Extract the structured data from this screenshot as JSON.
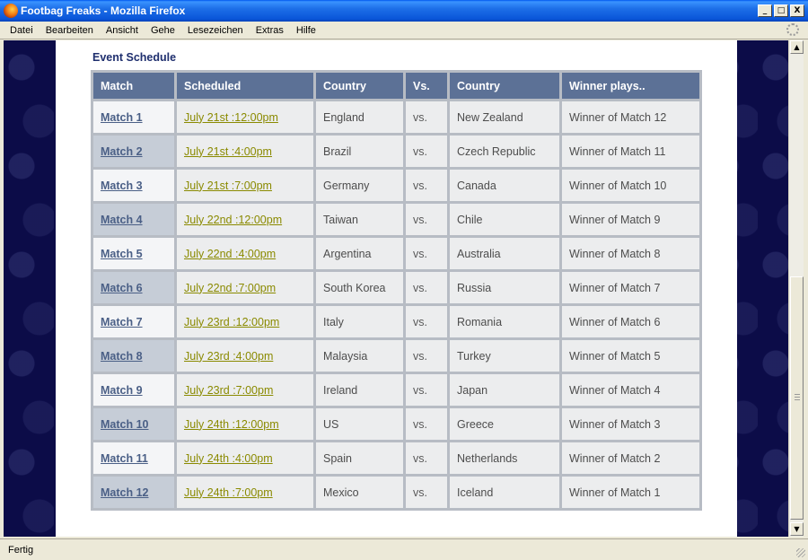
{
  "window": {
    "title": "Footbag Freaks - Mozilla Firefox",
    "controls": [
      "_",
      "□",
      "X"
    ]
  },
  "menu": {
    "items": [
      {
        "label": "Datei"
      },
      {
        "label": "Bearbeiten"
      },
      {
        "label": "Ansicht"
      },
      {
        "label": "Gehe"
      },
      {
        "label": "Lesezeichen"
      },
      {
        "label": "Extras"
      },
      {
        "label": "Hilfe"
      }
    ]
  },
  "page": {
    "section_title": "Event Schedule",
    "table": {
      "headers": [
        "Match",
        "Scheduled",
        "Country",
        "Vs.",
        "Country",
        "Winner plays.."
      ],
      "rows": [
        {
          "match": "Match 1",
          "scheduled": "July 21st :12:00pm",
          "country1": "England",
          "vs": "vs.",
          "country2": "New Zealand",
          "winner": "Winner of Match 12"
        },
        {
          "match": "Match 2",
          "scheduled": "July 21st :4:00pm",
          "country1": "Brazil",
          "vs": "vs.",
          "country2": "Czech Republic",
          "winner": "Winner of Match 11"
        },
        {
          "match": "Match 3",
          "scheduled": "July 21st :7:00pm",
          "country1": "Germany",
          "vs": "vs.",
          "country2": "Canada",
          "winner": "Winner of Match 10"
        },
        {
          "match": "Match 4",
          "scheduled": "July 22nd :12:00pm",
          "country1": "Taiwan",
          "vs": "vs.",
          "country2": "Chile",
          "winner": "Winner of Match 9"
        },
        {
          "match": "Match 5",
          "scheduled": "July 22nd :4:00pm",
          "country1": "Argentina",
          "vs": "vs.",
          "country2": "Australia",
          "winner": "Winner of Match 8"
        },
        {
          "match": "Match 6",
          "scheduled": "July 22nd :7:00pm",
          "country1": "South Korea",
          "vs": "vs.",
          "country2": "Russia",
          "winner": "Winner of Match 7"
        },
        {
          "match": "Match 7",
          "scheduled": "July 23rd :12:00pm",
          "country1": "Italy",
          "vs": "vs.",
          "country2": "Romania",
          "winner": "Winner of Match 6"
        },
        {
          "match": "Match 8",
          "scheduled": "July 23rd :4:00pm",
          "country1": "Malaysia",
          "vs": "vs.",
          "country2": "Turkey",
          "winner": "Winner of Match 5"
        },
        {
          "match": "Match 9",
          "scheduled": "July 23rd :7:00pm",
          "country1": "Ireland",
          "vs": "vs.",
          "country2": "Japan",
          "winner": "Winner of Match 4"
        },
        {
          "match": "Match 10",
          "scheduled": "July 24th :12:00pm",
          "country1": "US",
          "vs": "vs.",
          "country2": "Greece",
          "winner": "Winner of Match 3"
        },
        {
          "match": "Match 11",
          "scheduled": "July 24th :4:00pm",
          "country1": "Spain",
          "vs": "vs.",
          "country2": "Netherlands",
          "winner": "Winner of Match 2"
        },
        {
          "match": "Match 12",
          "scheduled": "July 24th :7:00pm",
          "country1": "Mexico",
          "vs": "vs.",
          "country2": "Iceland",
          "winner": "Winner of Match 1"
        }
      ]
    }
  },
  "statusbar": {
    "text": "Fertig"
  },
  "icons": {
    "app": "firefox-icon",
    "throbber": "throbber-icon",
    "scroll_up": "scroll-up-arrow-icon",
    "scroll_down": "scroll-down-arrow-icon",
    "resize": "resize-grip-icon"
  },
  "colors": {
    "header_bg": "#5c7196",
    "match_link": "#4a5f86",
    "schedule_link": "#8a8a00",
    "page_bg": "#0c0c48",
    "section_title": "#1f2f6e"
  }
}
